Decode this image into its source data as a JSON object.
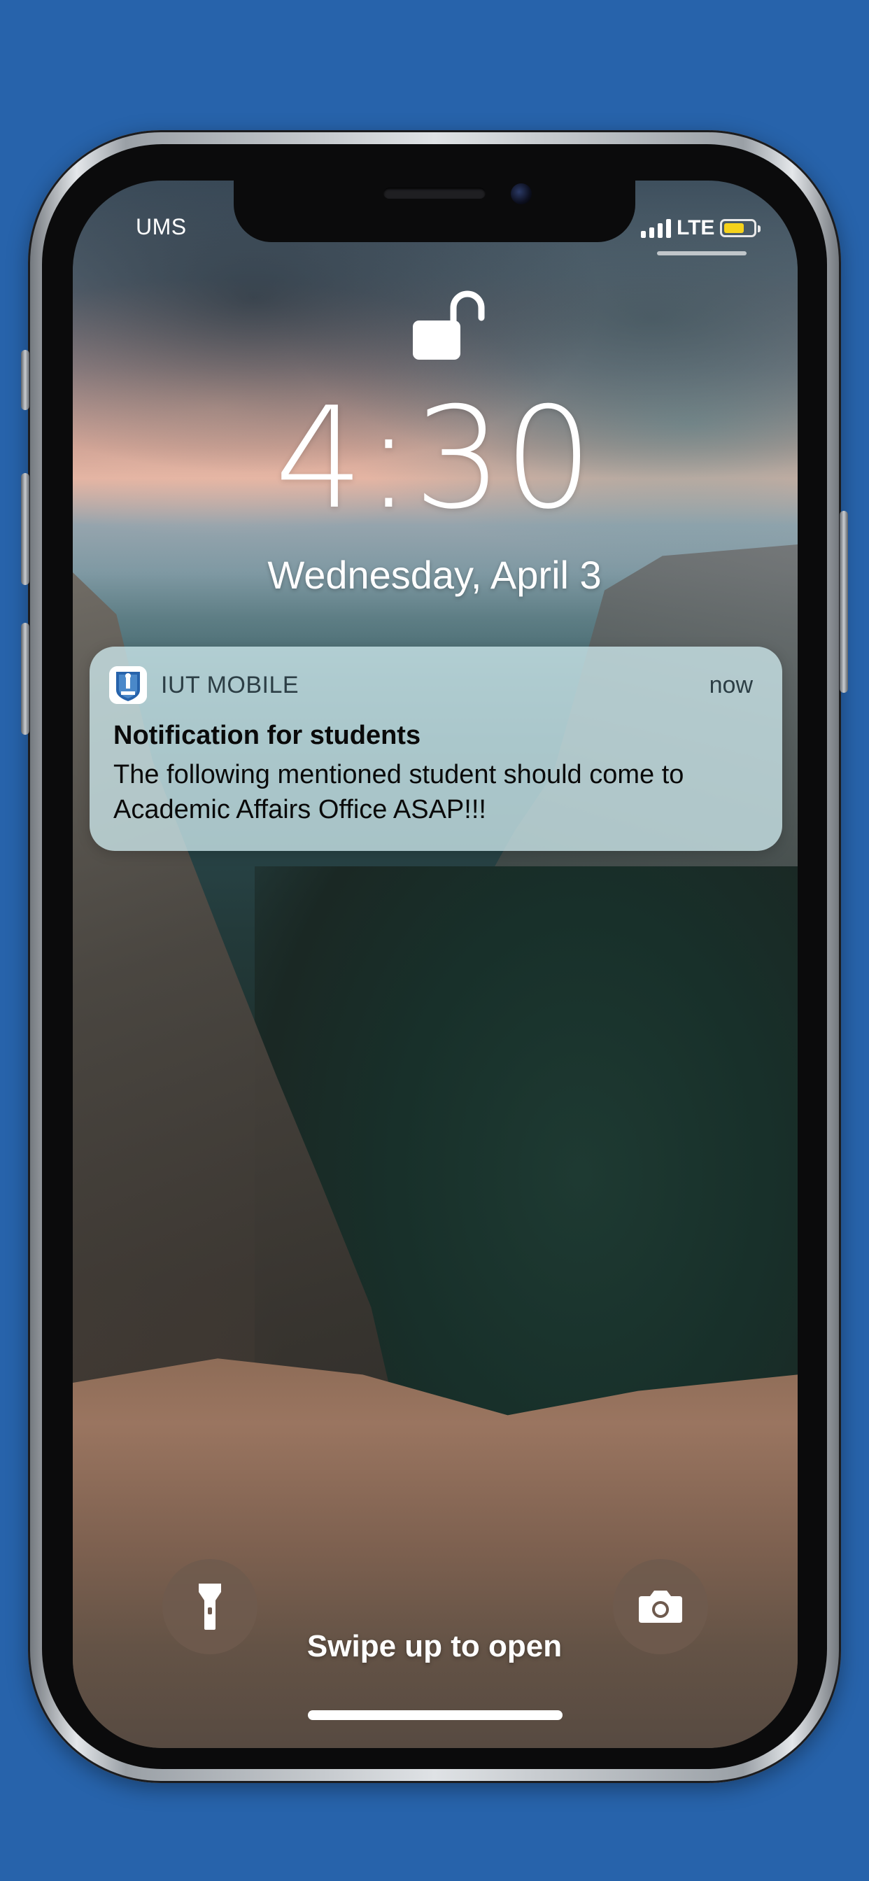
{
  "status_bar": {
    "carrier": "UMS",
    "network": "LTE",
    "signal_bars": 4,
    "battery_level": 0.7,
    "battery_color": "#f5d21b"
  },
  "lock_screen": {
    "lock_icon": "unlocked-padlock-icon",
    "time": "4:30",
    "date": "Wednesday, April 3"
  },
  "notification": {
    "app_icon": "iut-app-icon",
    "app_name": "IUT MOBILE",
    "time": "now",
    "title": "Notification for students",
    "body": "The following mentioned student should come to Academic Affairs Office ASAP!!!"
  },
  "bottom_controls": {
    "flashlight_icon": "flashlight-icon",
    "camera_icon": "camera-icon",
    "swipe_hint": "Swipe up to open"
  },
  "colors": {
    "background": "#2763ab",
    "notification_bg": "#cde8ec"
  }
}
